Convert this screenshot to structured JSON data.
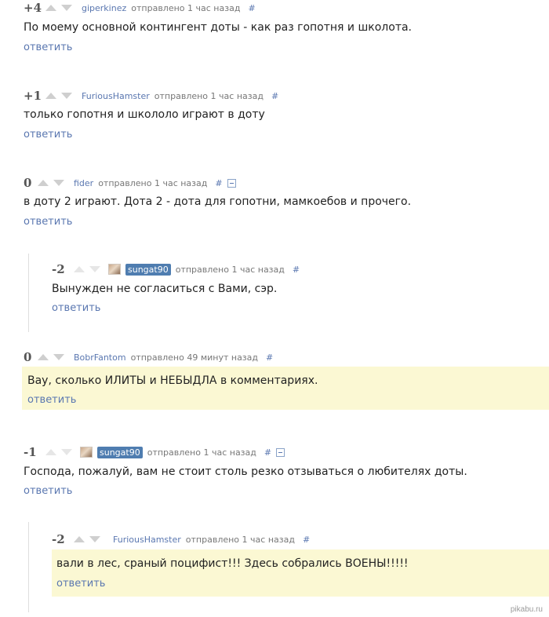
{
  "comments": [
    {
      "score": "+4",
      "author": "giperkinez",
      "meta": "отправлено 1 час назад",
      "hash": "#",
      "text": "По моему основной контингент доты - как раз гопотня и школота.",
      "reply": "ответить"
    },
    {
      "score": "+1",
      "author": "FuriousHamster",
      "meta": "отправлено 1 час назад",
      "hash": "#",
      "text": "только гопотня и школоло играют в доту",
      "reply": "ответить"
    },
    {
      "score": "0",
      "author": "fider",
      "meta": "отправлено 1 час назад",
      "hash": "#",
      "text": "в доту 2 играют. Дота 2 - дота для гопотни, мамкоебов и прочего.",
      "reply": "ответить"
    },
    {
      "score": "-2",
      "author": "sungat90",
      "meta": "отправлено 1 час назад",
      "hash": "#",
      "text": "Вынужден не согласиться с Вами, сэр.",
      "reply": "ответить"
    },
    {
      "score": "0",
      "author": "BobrFantom",
      "meta": "отправлено 49 минут назад",
      "hash": "#",
      "text": "Вау, сколько ИЛИТЫ и НЕБЫДЛА в комментариях.",
      "reply": "ответить"
    },
    {
      "score": "-1",
      "author": "sungat90",
      "meta": "отправлено 1 час назад",
      "hash": "#",
      "text": "Господа, пожалуй, вам не стоит столь резко отзываться о любителях доты.",
      "reply": "ответить"
    },
    {
      "score": "-2",
      "author": "FuriousHamster",
      "meta": "отправлено 1 час назад",
      "hash": "#",
      "text": "вали в лес, сраный поцифист!!! Здесь собрались ВОЕНЫ!!!!!",
      "reply": "ответить"
    }
  ],
  "watermark": "pikabu.ru",
  "colors": {
    "author_link": "#5a77b0",
    "highlight": "#fbf8d3",
    "badge": "#4f7db0"
  }
}
